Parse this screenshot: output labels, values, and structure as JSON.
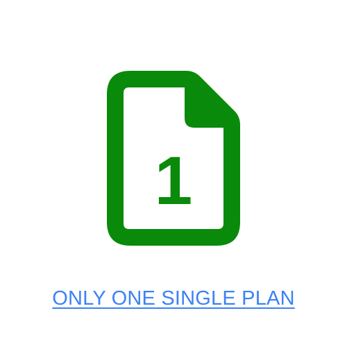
{
  "icon": {
    "name": "document-number-one-icon",
    "glyph": "1",
    "color": "#0a8a0a"
  },
  "link": {
    "label": "ONLY ONE SINGLE PLAN",
    "color": "#3b82f6"
  }
}
